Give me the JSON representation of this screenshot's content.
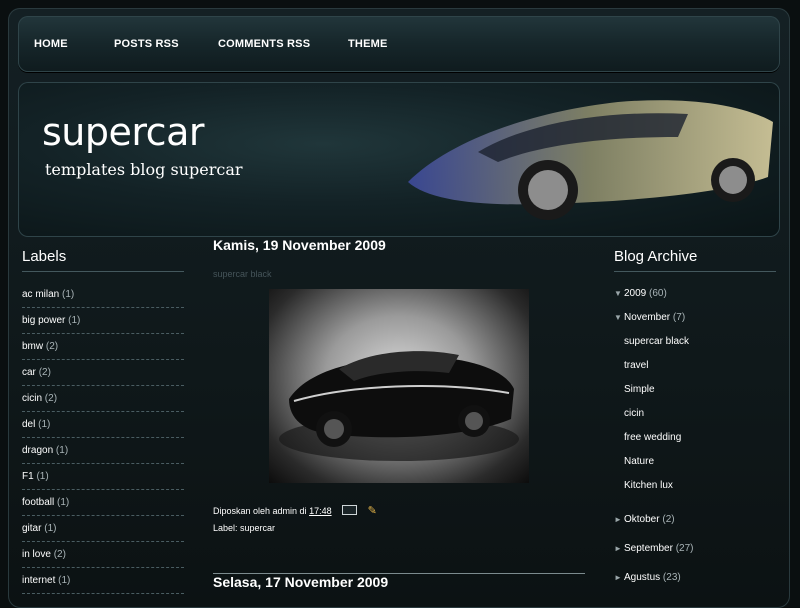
{
  "nav": {
    "items": [
      "HOME",
      "POSTS RSS",
      "COMMENTS RSS",
      "THEME"
    ]
  },
  "header": {
    "title": "supercar",
    "description": "templates blog supercar"
  },
  "labels_widget": {
    "title": "Labels",
    "items": [
      {
        "label": "ac milan",
        "count": "(1)"
      },
      {
        "label": "big power",
        "count": "(1)"
      },
      {
        "label": "bmw",
        "count": "(2)"
      },
      {
        "label": "car",
        "count": "(2)"
      },
      {
        "label": "cicin",
        "count": "(2)"
      },
      {
        "label": "del",
        "count": "(1)"
      },
      {
        "label": "dragon",
        "count": "(1)"
      },
      {
        "label": "F1",
        "count": "(1)"
      },
      {
        "label": "football",
        "count": "(1)"
      },
      {
        "label": "gitar",
        "count": "(1)"
      },
      {
        "label": "in love",
        "count": "(2)"
      },
      {
        "label": "internet",
        "count": "(1)"
      }
    ]
  },
  "post": {
    "date": "Kamis, 19 November 2009",
    "title": "supercar black",
    "posted_by": "Diposkan oleh admin di ",
    "time": "17:48",
    "labels_prefix": "Label: ",
    "label": "supercar"
  },
  "next_date": "Selasa, 17 November 2009",
  "archive": {
    "title": "Blog Archive",
    "year": {
      "label": "2009",
      "count": "(60)"
    },
    "month": {
      "label": "November",
      "count": "(7)"
    },
    "posts": [
      "supercar black",
      "travel",
      "Simple",
      "cicin",
      "free wedding",
      "Nature",
      "Kitchen lux"
    ],
    "other_months": [
      {
        "label": "Oktober",
        "count": "(2)"
      },
      {
        "label": "September",
        "count": "(27)"
      },
      {
        "label": "Agustus",
        "count": "(23)"
      }
    ]
  }
}
